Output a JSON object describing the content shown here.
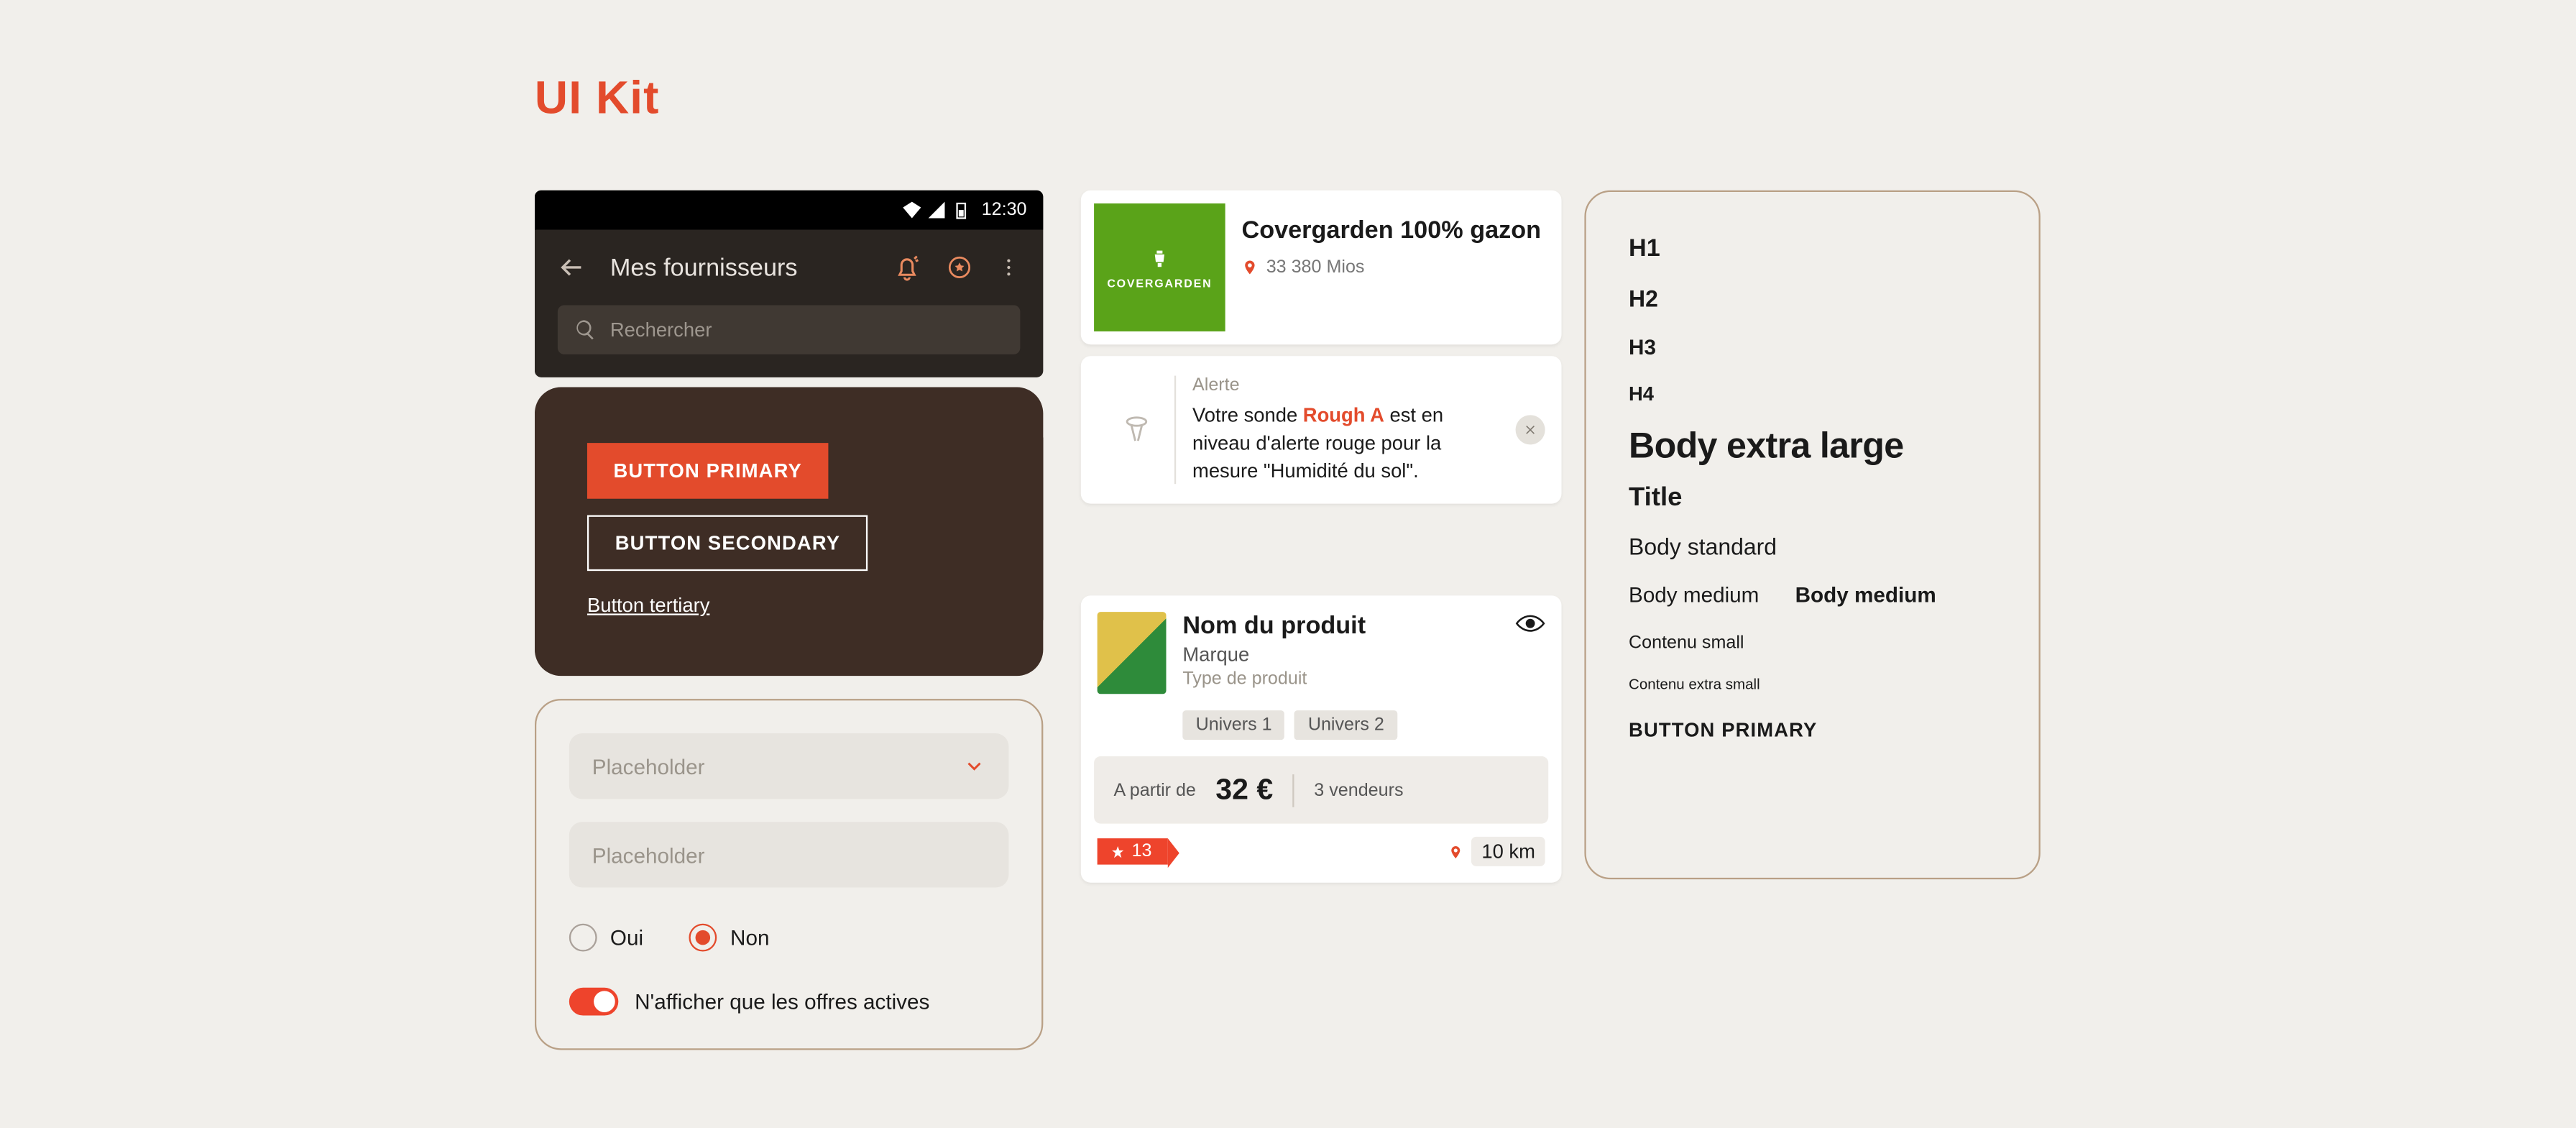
{
  "page_title": "UI Kit",
  "phone": {
    "clock": "12:30",
    "title": "Mes fournisseurs",
    "search_placeholder": "Rechercher"
  },
  "buttons": {
    "primary": "BUTTON PRIMARY",
    "secondary": "BUTTON SECONDARY",
    "tertiary": "Button tertiary"
  },
  "form": {
    "select_placeholder": "Placeholder",
    "text_placeholder": "Placeholder",
    "radio_yes": "Oui",
    "radio_no": "Non",
    "toggle_label": "N'afficher que les offres actives"
  },
  "supplier": {
    "logo_text": "COVERGARDEN",
    "name": "Covergarden 100% gazon",
    "location": "33 380 Mios"
  },
  "alert": {
    "title": "Alerte",
    "pre": "Votre sonde ",
    "em": "Rough A",
    "post": " est en niveau d'alerte rouge pour la mesure \"Humidité du sol\"."
  },
  "product": {
    "name": "Nom du produit",
    "brand": "Marque",
    "type": "Type de produit",
    "chips": [
      "Univers 1",
      "Univers 2"
    ],
    "price_prefix": "A partir de",
    "price": "32 €",
    "sellers": "3 vendeurs",
    "flag_count": "13",
    "distance": "10 km"
  },
  "typo": {
    "h1": "H1",
    "h2": "H2",
    "h3": "H3",
    "h4": "H4",
    "body_xl": "Body extra large",
    "title": "Title",
    "body_std": "Body standard",
    "body_med": "Body medium",
    "body_med_bold": "Body medium",
    "small": "Contenu small",
    "xs": "Contenu extra small",
    "button": "BUTTON PRIMARY"
  }
}
